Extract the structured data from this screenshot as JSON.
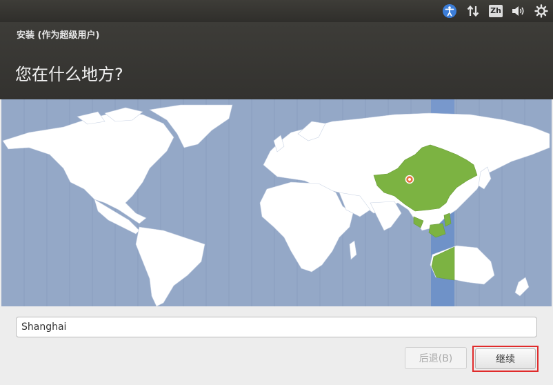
{
  "top_panel": {
    "icons": [
      "accessibility-icon",
      "network-icon",
      "keyboard-language-icon",
      "volume-icon",
      "settings-gear-icon"
    ],
    "keyboard_indicator": "Zh"
  },
  "header": {
    "window_title": "安装 (作为超级用户)",
    "question": "您在什么地方?"
  },
  "map": {
    "ocean_color": "#94a8c7",
    "land_color": "#ffffff",
    "selected_zone_color": "#7cb342",
    "highlight_band_color": "#6f92c8",
    "marker_color": "#e8733f"
  },
  "location": {
    "value": "Shanghai"
  },
  "buttons": {
    "back_label": "后退(B)",
    "continue_label": "继续"
  }
}
